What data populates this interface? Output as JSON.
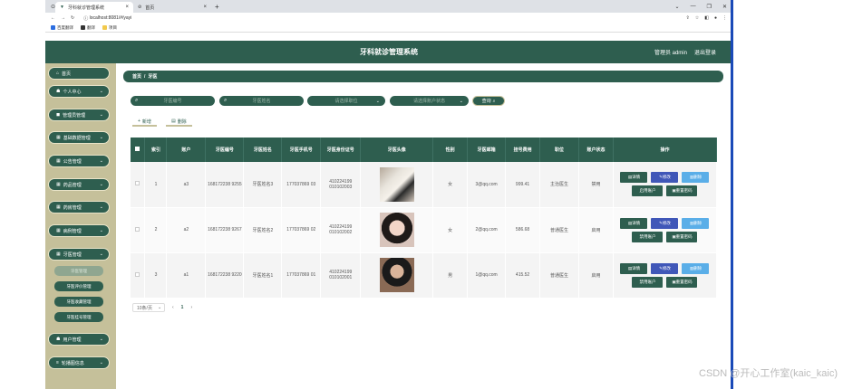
{
  "browser": {
    "tabs": [
      {
        "title": "牙科就诊管理系统"
      },
      {
        "title": "首页"
      }
    ],
    "url": "localhost:8081/#/yayi",
    "bookmarks": [
      "百度翻译",
      "翻译",
      "项目"
    ],
    "win_controls": [
      "⌄",
      "—",
      "❐",
      "✕"
    ]
  },
  "header": {
    "title": "牙科就诊管理系统",
    "user": "管理员 admin",
    "logout": "退出登录"
  },
  "sidebar": {
    "items": [
      {
        "label": "首页",
        "icon": "home-icon",
        "glyph": "⌂"
      },
      {
        "label": "个人中心",
        "icon": "user-icon",
        "glyph": "☗"
      },
      {
        "label": "管理员管理",
        "icon": "admin-icon",
        "glyph": "◼"
      },
      {
        "label": "基础数据管理",
        "icon": "grid-icon",
        "glyph": "▦"
      },
      {
        "label": "公告管理",
        "icon": "grid-icon",
        "glyph": "▦"
      },
      {
        "label": "药品管理",
        "icon": "grid-icon",
        "glyph": "▦"
      },
      {
        "label": "药房管理",
        "icon": "grid-icon",
        "glyph": "▦"
      },
      {
        "label": "病例管理",
        "icon": "grid-icon",
        "glyph": "▦"
      },
      {
        "label": "牙医管理",
        "icon": "grid-icon",
        "glyph": "▦"
      }
    ],
    "subitems": [
      {
        "label": "牙医管理",
        "active": true
      },
      {
        "label": "牙医评价管理",
        "active": false
      },
      {
        "label": "牙医收藏管理",
        "active": false
      },
      {
        "label": "牙医挂号管理",
        "active": false
      }
    ],
    "items_after": [
      {
        "label": "用户管理",
        "icon": "user-icon",
        "glyph": "☗"
      },
      {
        "label": "轮播图信息",
        "icon": "list-icon",
        "glyph": "≡"
      }
    ]
  },
  "breadcrumb": {
    "home": "首页",
    "sep": "/",
    "current": "牙医"
  },
  "search": {
    "dentist_no": "牙医编号",
    "dentist_name": "牙医姓名",
    "title_select": "请选择职位",
    "account_select": "请选择账户状态",
    "button": "查询"
  },
  "ops": {
    "add": "新增",
    "delete": "删除"
  },
  "table": {
    "headers": [
      "索引",
      "账户",
      "牙医编号",
      "牙医姓名",
      "牙医手机号",
      "牙医身份证号",
      "牙医头像",
      "性别",
      "牙医邮箱",
      "挂号费用",
      "职位",
      "账户状态",
      "操作"
    ],
    "rows": [
      {
        "index": "1",
        "account": "a3",
        "no": "168172238 9255",
        "name": "牙医姓名3",
        "phone": "177037869 03",
        "idcard": "410224199 010102003",
        "gender": "女",
        "email": "3@qq.com",
        "fee": "999.41",
        "title": "主治医生",
        "status": "禁用",
        "toggle": "启用账户"
      },
      {
        "index": "2",
        "account": "a2",
        "no": "168172238 9267",
        "name": "牙医姓名2",
        "phone": "177037869 02",
        "idcard": "410224199 010102002",
        "gender": "女",
        "email": "2@qq.com",
        "fee": "586.68",
        "title": "普通医生",
        "status": "启用",
        "toggle": "禁用账户"
      },
      {
        "index": "3",
        "account": "a1",
        "no": "168172238 9220",
        "name": "牙医姓名1",
        "phone": "177037869 01",
        "idcard": "410224199 010102001",
        "gender": "男",
        "email": "1@qq.com",
        "fee": "415.52",
        "title": "普通医生",
        "status": "启用",
        "toggle": "禁用账户"
      }
    ],
    "actions": {
      "detail": "详情",
      "edit": "修改",
      "delete": "删除",
      "reset": "重置密码"
    }
  },
  "pager": {
    "size": "10条/页",
    "prev": "‹",
    "page": "1",
    "next": "›"
  },
  "watermark": "CSDN @开心工作室(kaic_kaic)"
}
